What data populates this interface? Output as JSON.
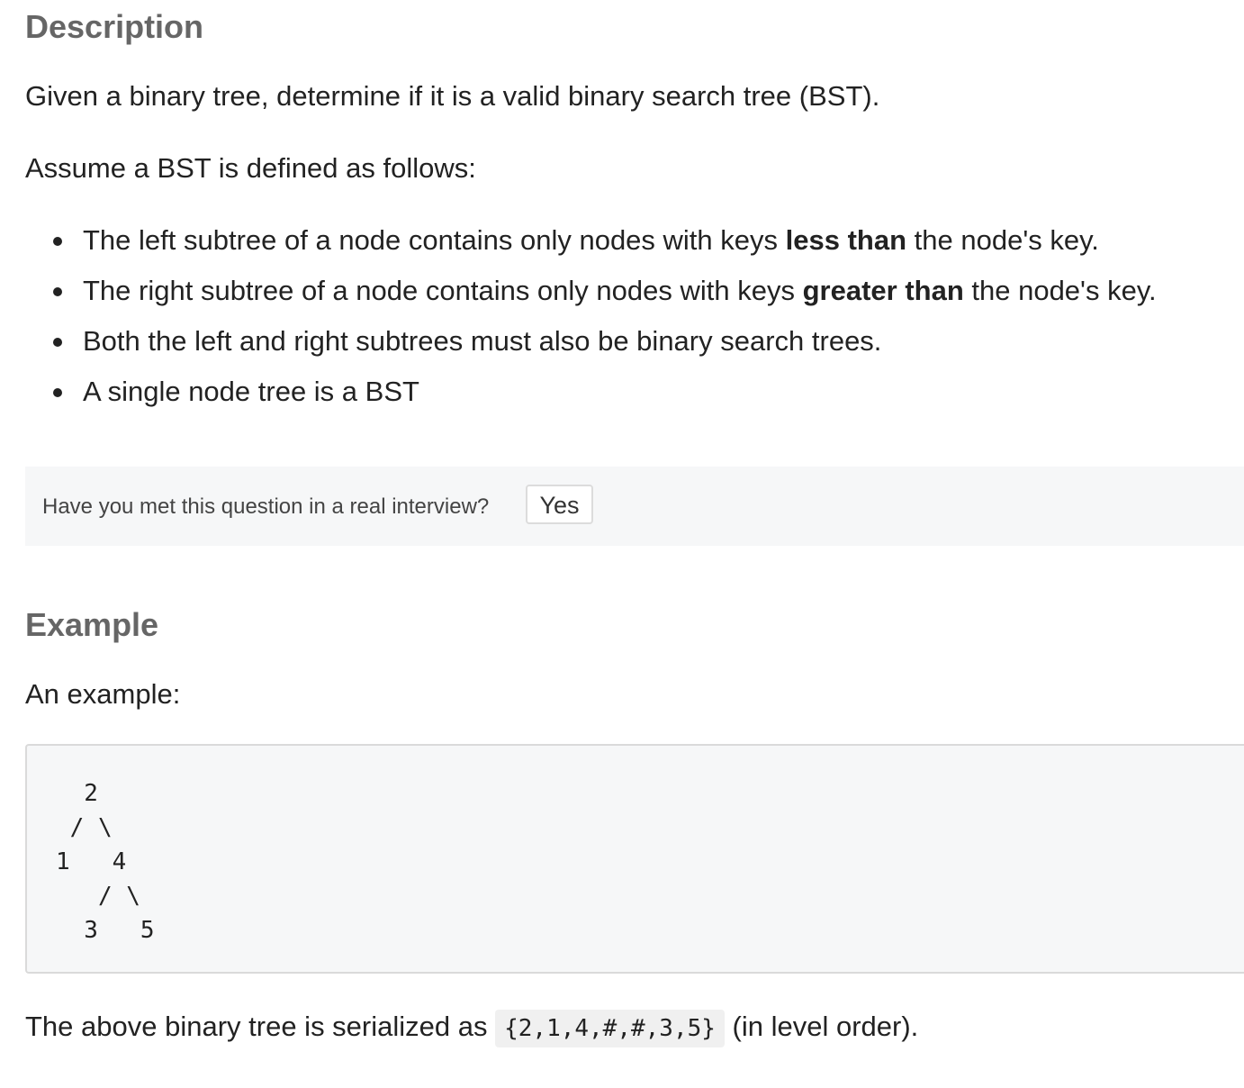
{
  "description": {
    "heading": "Description",
    "intro": "Given a binary tree, determine if it is a valid binary search tree (BST).",
    "assume": "Assume a BST is defined as follows:",
    "rules": [
      {
        "before": "The left subtree of a node contains only nodes with keys ",
        "bold": "less than",
        "after": " the node's key."
      },
      {
        "before": "The right subtree of a node contains only nodes with keys ",
        "bold": "greater than",
        "after": " the node's key."
      },
      {
        "before": "Both the left and right subtrees must also be binary search trees.",
        "bold": "",
        "after": ""
      },
      {
        "before": "A single node tree is a BST",
        "bold": "",
        "after": ""
      }
    ]
  },
  "interview": {
    "question": "Have you met this question in a real interview?",
    "yes_label": "Yes"
  },
  "example": {
    "heading": "Example",
    "intro": "An example:",
    "tree": "  2\n / \\\n1   4\n   / \\\n  3   5",
    "serialized_before": "The above binary tree is serialized as ",
    "serialized_code": "{2,1,4,#,#,3,5}",
    "serialized_after": " (in level order)."
  }
}
